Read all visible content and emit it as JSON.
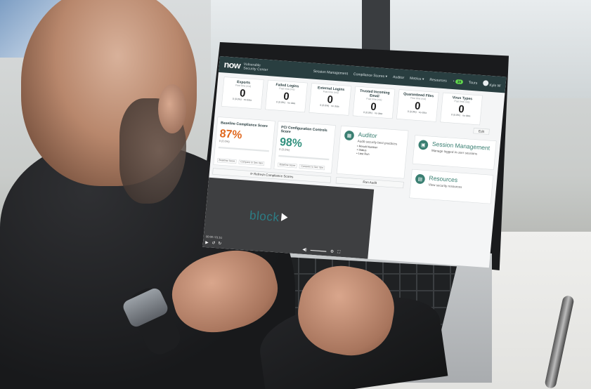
{
  "app": {
    "logo": "now",
    "product_line1": "Vulnerable",
    "product_line2": "Security Center"
  },
  "nav": {
    "items": [
      "Session Management",
      "Compliance Scores ▾",
      "Auditor",
      "Metrics ▾",
      "Resources"
    ],
    "notification_count": "34",
    "tours_label": "Tours",
    "user_label": "Kyle W"
  },
  "stats": [
    {
      "title": "Exports",
      "subtitle": "Past time (n/a)",
      "value": "0",
      "footer": "0 (0.0%) · no data"
    },
    {
      "title": "Failed Logins",
      "subtitle": "Past time (n/a)",
      "value": "0",
      "footer": "0 (0.0%) · no data"
    },
    {
      "title": "External Logins",
      "subtitle": "Past time (n/a)",
      "value": "0",
      "footer": "0 (0.0%) · no data"
    },
    {
      "title": "Trusted Incoming Email",
      "subtitle": "Past time (n/a)",
      "value": "0",
      "footer": "0 (0.0%) · no data"
    },
    {
      "title": "Quarantined Files",
      "subtitle": "Past time (n/a)",
      "value": "0",
      "footer": "0 (0.0%) · no data"
    },
    {
      "title": "Virus Types",
      "subtitle": "Past time (n/a)",
      "value": "0",
      "footer": "0 (0.0%) · no data"
    }
  ],
  "scores": [
    {
      "title": "Baseline Compliance Score",
      "value": "87%",
      "sub": "0 (0.0%)",
      "color": "#e0671d",
      "foot_left": "Baseline Score",
      "foot_right": "Compare to Sec Ops"
    },
    {
      "title": "PCI Configuration Controls Score",
      "value": "98%",
      "sub": "0 (0.0%)",
      "color": "#2f8f7c",
      "foot_left": "Baseline Score",
      "foot_right": "Compare to Sec Ops"
    }
  ],
  "widgets": {
    "auditor": {
      "title": "Auditor",
      "desc": "Audit security best practices",
      "list": [
        "Result Number",
        "Status",
        "Last Run"
      ],
      "button": "Run Audit"
    },
    "session": {
      "title": "Session Management",
      "desc": "Manage logged in user sessions"
    },
    "resources": {
      "title": "Resources",
      "desc": "View security resources"
    }
  },
  "buttons": {
    "refresh": "⟳ Refresh Compliance Scores",
    "edit": "Edit"
  },
  "video": {
    "brand": "block",
    "time": "00:00 / 01:51"
  },
  "colors": {
    "header_bg": "#293e40",
    "accent": "#3a7f72",
    "orange": "#e0671d"
  }
}
